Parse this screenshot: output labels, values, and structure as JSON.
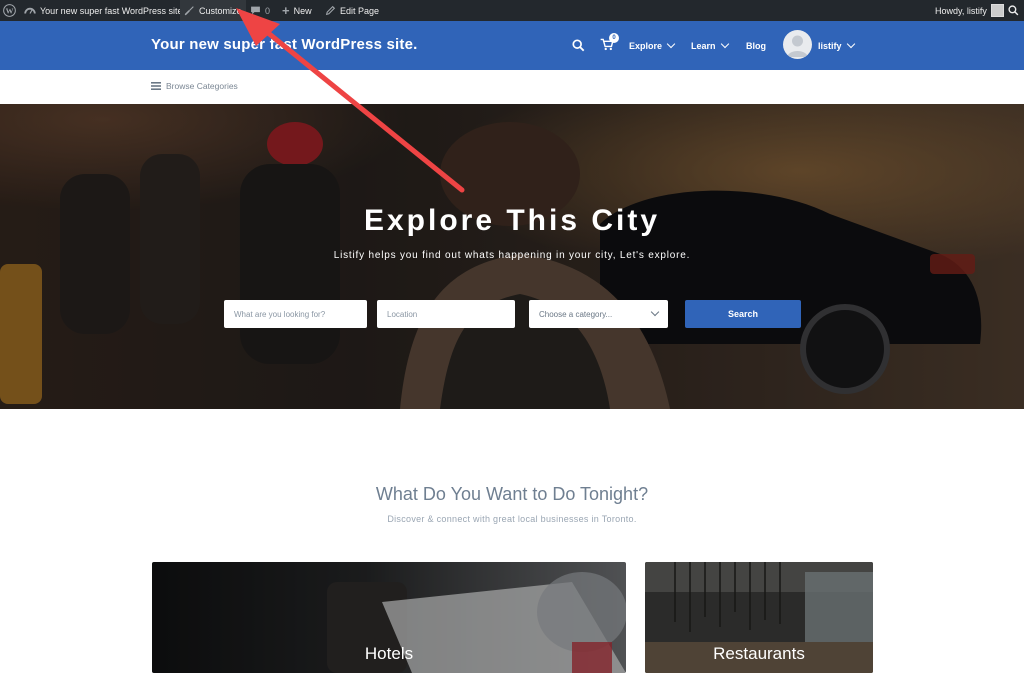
{
  "admin_bar": {
    "site_name": "Your new super fast WordPress site.",
    "customize": "Customize",
    "comments_count": "0",
    "new": "New",
    "edit_page": "Edit Page",
    "howdy": "Howdy, listify"
  },
  "header": {
    "site_title": "Your new super fast WordPress site.",
    "cart_count": "0",
    "nav": {
      "explore": "Explore",
      "learn": "Learn",
      "blog": "Blog",
      "user": "listify"
    }
  },
  "subnav": {
    "browse_categories": "Browse Categories"
  },
  "hero": {
    "title": "Explore This City",
    "subtitle": "Listify helps you find out whats happening in your city, Let's explore.",
    "search_placeholder": "What are you looking for?",
    "location_placeholder": "Location",
    "category_selected": "Choose a category...",
    "search_button": "Search"
  },
  "section": {
    "title": "What Do You Want to Do Tonight?",
    "subtitle": "Discover & connect with great local businesses in Toronto."
  },
  "cards": [
    {
      "label": "Hotels"
    },
    {
      "label": "Restaurants"
    }
  ],
  "colors": {
    "admin_bar": "#23282d",
    "brand_blue": "#3064b8",
    "annotation_arrow": "#ee4444"
  }
}
